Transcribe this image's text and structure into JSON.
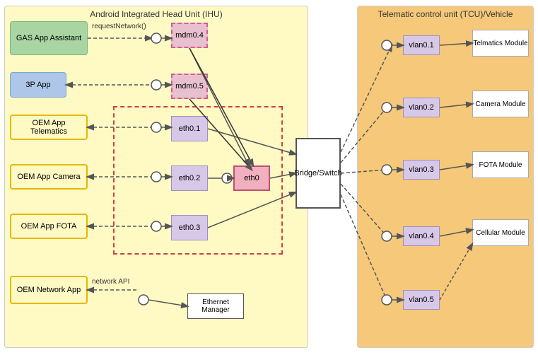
{
  "ihu": {
    "title": "Android Integrated Head Unit (IHU)",
    "apps": {
      "gas": "GAS App Assistant",
      "three_p": "3P App",
      "oem_telematics": "OEM App Telematics",
      "oem_camera": "OEM App Camera",
      "oem_fota": "OEM App FOTA",
      "oem_network": "OEM Network App"
    },
    "mdm": {
      "mdm04": "mdm0.4",
      "mdm05": "mdm0.5"
    },
    "eth": {
      "eth01": "eth0.1",
      "eth02": "eth0.2",
      "eth03": "eth0.3",
      "eth0": "eth0"
    },
    "labels": {
      "request_network": "requestNetwork()",
      "network_api": "network API"
    },
    "bridge": "Bridge/Switch",
    "eth_manager": "Ethernet Manager"
  },
  "tcu": {
    "title": "Telematic control unit (TCU)/Vehicle",
    "vlans": [
      "vlan0.1",
      "vlan0.2",
      "vlan0.3",
      "vlan0.4",
      "vlan0.5"
    ],
    "modules": [
      "Telmatics Module",
      "Camera Module",
      "FOTA Module",
      "Cellular Module"
    ]
  }
}
